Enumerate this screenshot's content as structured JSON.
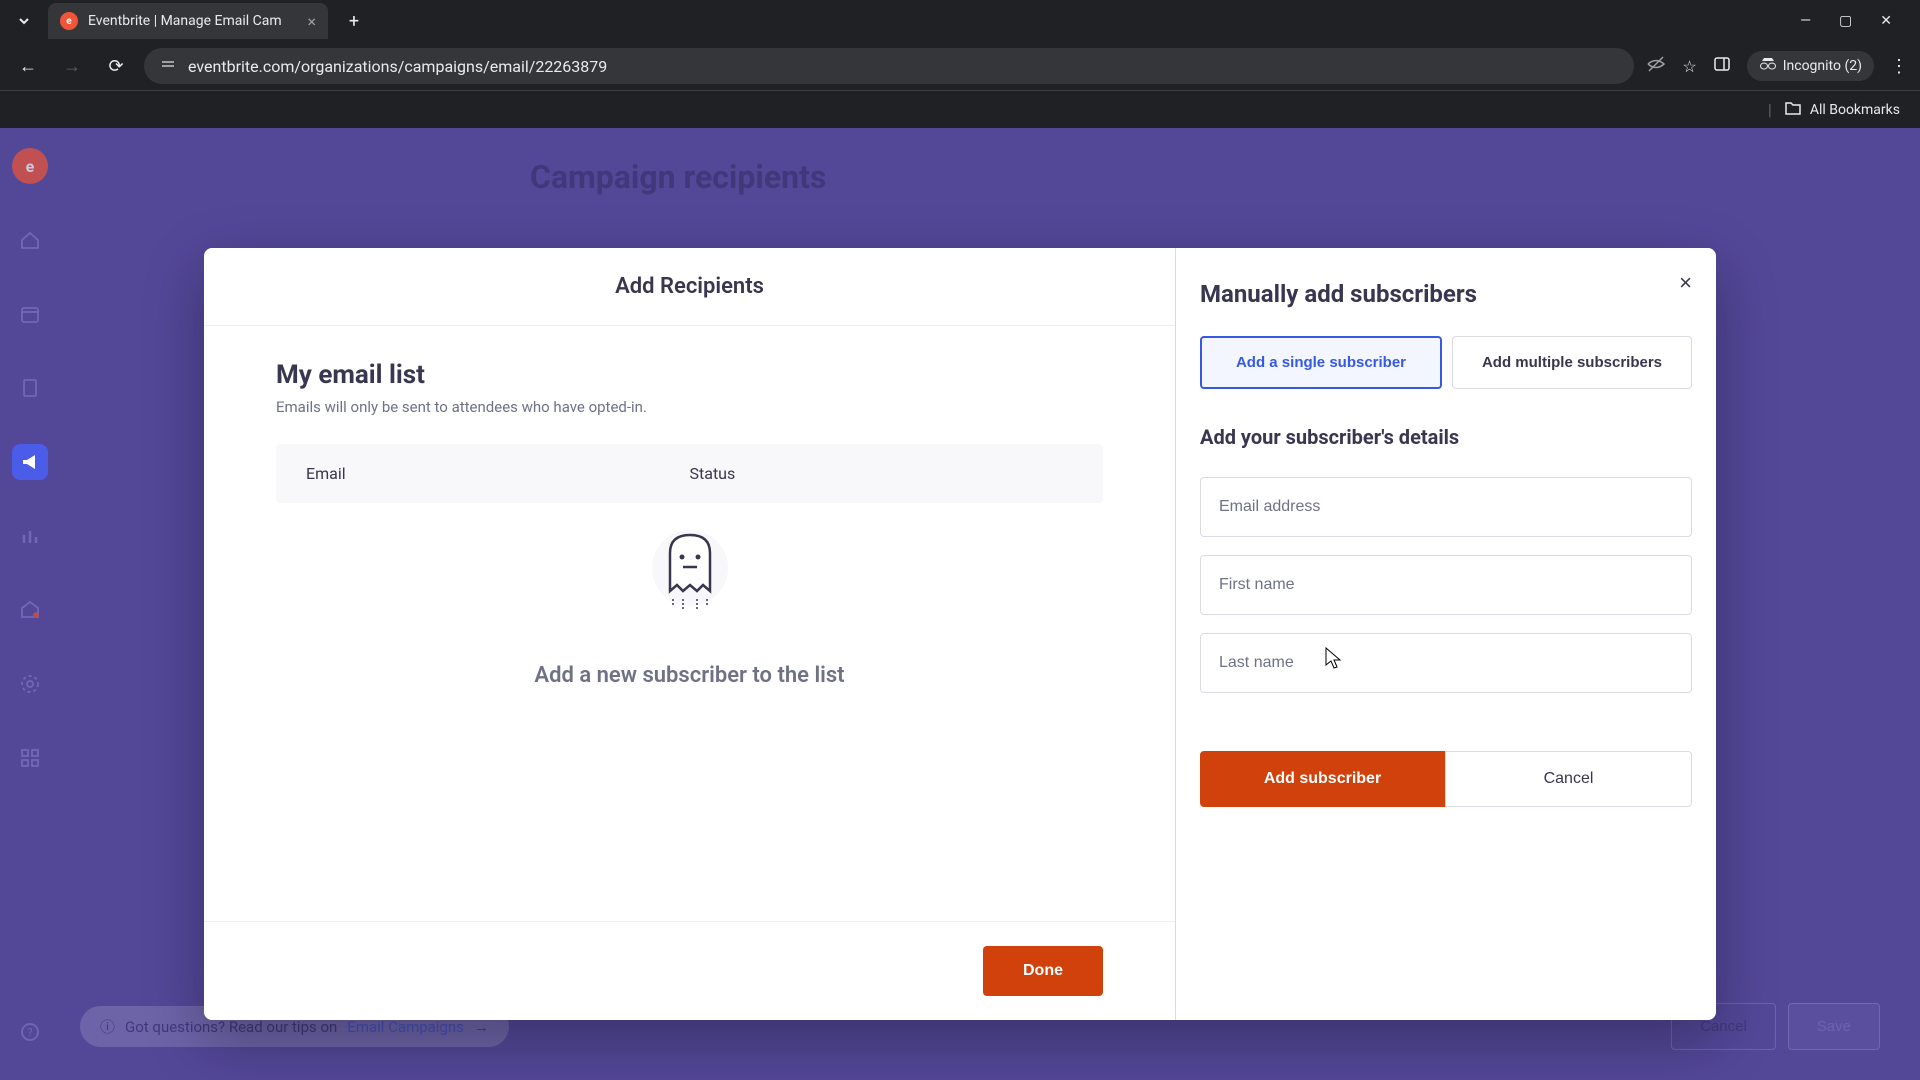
{
  "browser": {
    "tab_title": "Eventbrite | Manage Email Cam",
    "url": "eventbrite.com/organizations/campaigns/email/22263879",
    "incognito_label": "Incognito (2)",
    "all_bookmarks": "All Bookmarks"
  },
  "background": {
    "page_title": "Campaign recipients",
    "tip_prefix": "Got questions? Read our tips on ",
    "tip_link": "Email Campaigns",
    "cancel_label": "Cancel",
    "save_label": "Save"
  },
  "modal": {
    "title": "Add Recipients",
    "left": {
      "list_name": "My email list",
      "list_desc": "Emails will only be sent to attendees who have opted-in.",
      "th_email": "Email",
      "th_status": "Status",
      "empty_text": "Add a new subscriber to the list",
      "done_label": "Done"
    },
    "right": {
      "title": "Manually add subscribers",
      "tab_single": "Add a single subscriber",
      "tab_multiple": "Add multiple subscribers",
      "form_title": "Add your subscriber's details",
      "email_placeholder": "Email address",
      "first_name_placeholder": "First name",
      "last_name_placeholder": "Last name",
      "add_label": "Add subscriber",
      "cancel_label": "Cancel"
    }
  }
}
